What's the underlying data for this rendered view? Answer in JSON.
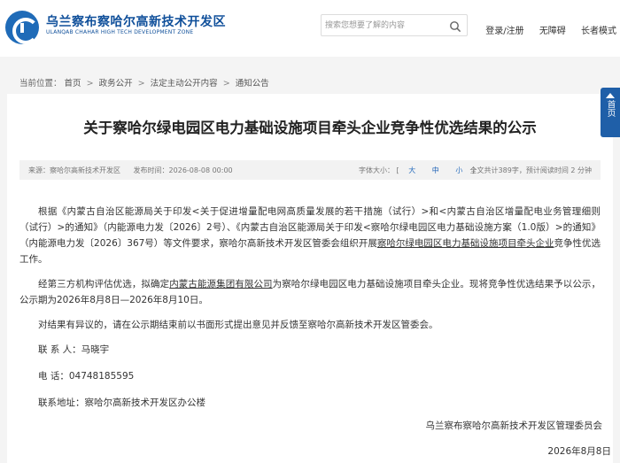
{
  "header": {
    "logo_title": "乌兰察布察哈尔高新技术开发区",
    "logo_sub": "ULANQAB CHAHAR HIGH TECH DEVELOPMENT ZONE",
    "search_placeholder": "搜索您想要了解的内容",
    "links": [
      "登录/注册",
      "无障碍",
      "长者模式"
    ]
  },
  "breadcrumb": {
    "prefix": "当前位置：",
    "items": [
      "首页",
      "政务公开",
      "法定主动公开内容",
      "通知公告"
    ],
    "separator": ">"
  },
  "article": {
    "title": "关于察哈尔绿电园区电力基础设施项目牵头企业竞争性优选结果的公示",
    "source": "来源：察哈尔高新技术开发区",
    "publish_time": "发布时间：2026-08-08 00:00",
    "font_size_label": "字体大小：",
    "font_sizes": [
      "大",
      "中",
      "小"
    ],
    "stats": "全文共计389字，预计阅读时间 2 分钟",
    "para1_a": "根据《内蒙古自治区能源局关于印发<关于促进增量配电网高质量发展的若干措施（试行）>和<内蒙古自治区增量配电业务管理细则（试行）>的通知》（内能源电力发〔2026〕2号）、《内蒙古自治区能源局关于印发<察哈尔绿电园区电力基础设施方案（1.0版）>的通知》（内能源电力发〔2026〕367号）等文件要求，察哈尔高新技术开发区管委会组织开展",
    "para1_link": "察哈尔绿电园区电力基础设施项目牵头企业",
    "para1_b": "竞争性优选工作。",
    "para2_a": "经第三方机构评估优选，拟确定",
    "para2_link": "内蒙古能源集团有限公司",
    "para2_b": "为察哈尔绿电园区电力基础设施项目牵头企业。现将竞争性优选结果予以公示，公示期为2026年8月8日—2026年8月10日。",
    "para3": "对结果有异议的，请在公示期结束前以书面形式提出意见并反馈至察哈尔高新技术开发区管委会。",
    "contact": "联 系 人：马晓宇",
    "phone": "电    话：04748185595",
    "address": "联系地址：察哈尔高新技术开发区办公楼",
    "sign_org": "乌兰察布察哈尔高新技术开发区管理委员会",
    "sign_date": "2026年8月8日"
  },
  "back_top": {
    "label": "首页"
  },
  "colors": {
    "brand": "#0f4f9a",
    "back_top_bg": "#1f5fa8",
    "band_bg": "#f4f4f4"
  },
  "icons": [
    "logo-icon",
    "search-icon",
    "arrow-up-icon"
  ]
}
